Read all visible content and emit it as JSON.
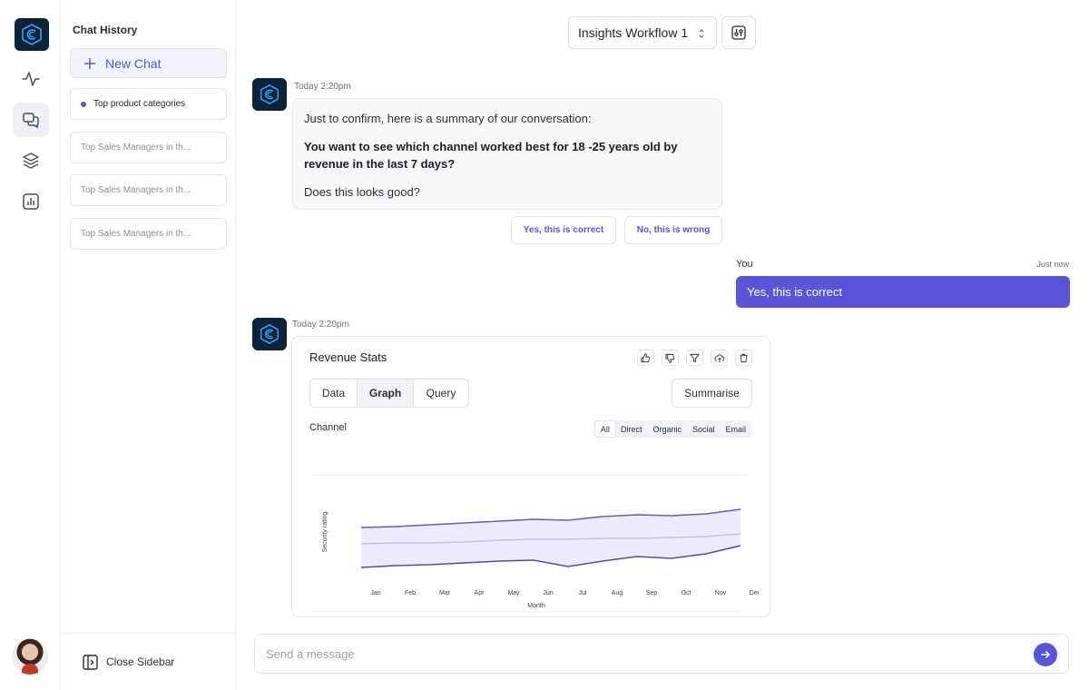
{
  "sidebar": {
    "history_title": "Chat History",
    "new_chat_label": "New Chat",
    "items": [
      {
        "label": "Top product categories",
        "active": true
      },
      {
        "label": "Top Sales Managers in th...",
        "active": false
      },
      {
        "label": "Top Sales Managers in th...",
        "active": false
      },
      {
        "label": "Top Sales Managers in th...",
        "active": false
      }
    ],
    "close_label": "Close Sidebar"
  },
  "header": {
    "workflow": "Insights Workflow 1"
  },
  "conversation": {
    "msg1": {
      "time": "Today 2:20pm",
      "line1": "Just to confirm, here is a summary of our conversation:",
      "line2": "You want to see which channel worked best for 18 -25 years old by revenue in the last 7 days?",
      "line3": "Does this looks good?",
      "yes_label": "Yes, this is correct",
      "no_label": "No, this is wrong"
    },
    "user": {
      "name": "You",
      "time": "Just now",
      "text": "Yes, this is correct"
    },
    "msg2": {
      "time": "Today 2:20pm"
    }
  },
  "card": {
    "title": "Revenue Stats",
    "tabs": [
      "Data",
      "Graph",
      "Query"
    ],
    "active_tab": "Graph",
    "summarise_label": "Summarise",
    "channel_label": "Channel",
    "filters": [
      "All",
      "Direct",
      "Organic",
      "Social",
      "Email"
    ],
    "active_filter": "All"
  },
  "chart_data": {
    "type": "area",
    "title": "",
    "xlabel": "Month",
    "ylabel": "Security rating",
    "categories": [
      "Jan",
      "Feb",
      "Mar",
      "Apr",
      "May",
      "Jun",
      "Jul",
      "Aug",
      "Sep",
      "Oct",
      "Nov",
      "Dec"
    ],
    "ylim": [
      0,
      100
    ],
    "series": [
      {
        "values": [
          52,
          53,
          55,
          57,
          59,
          61,
          60,
          64,
          66,
          65,
          67,
          72
        ]
      },
      {
        "values": [
          34,
          35,
          35,
          36,
          38,
          39,
          39,
          40,
          40,
          41,
          42,
          45
        ]
      },
      {
        "values": [
          8,
          10,
          11,
          13,
          15,
          16,
          9,
          15,
          20,
          18,
          23,
          32
        ]
      }
    ],
    "colors": [
      "#6b5bb8",
      "#c9b9ee",
      "#5b4aa8"
    ],
    "fill_color": "#efeafb",
    "grid": false
  },
  "composer": {
    "placeholder": "Send a message"
  },
  "colors": {
    "accent": "#5a55d6",
    "logo_bg": "#0d2438"
  }
}
